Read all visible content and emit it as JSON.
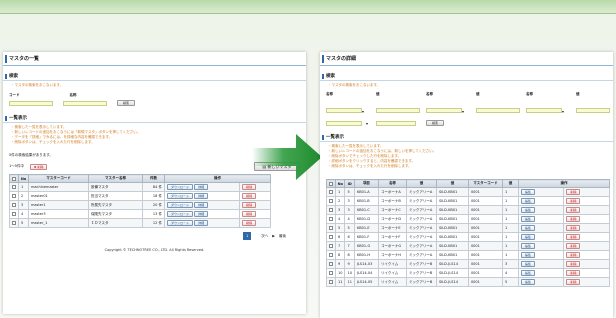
{
  "left": {
    "title": "マスタの一覧",
    "search_section": "検索",
    "search_note": "・マスタの検索をおこないます。",
    "code_label": "コード",
    "name_label": "名称",
    "search_button": "検索",
    "list_section": "一覧表示",
    "list_notes": [
      "・検索した一覧を表示しています。",
      "・新しいレコードの追加をおこなうには「新規マスタ」ボタンを押してください。",
      "・データを「詳細」でみるには、を詳細な内容を確認できます。",
      "・削除ボタンは、チェックを入れた行を削除します。"
    ],
    "result_count": "5件の検索結果があります。",
    "page_info": "1～5件中",
    "delete_button": "削除",
    "new_button": "新しいマスタ",
    "columns": [
      "",
      "No",
      "マスターコード",
      "マスター名称",
      "件数",
      "",
      "操作"
    ],
    "rows": [
      {
        "no": "1",
        "code": "machinemaster",
        "name": "設備マスタ",
        "count": "84 件"
      },
      {
        "no": "2",
        "code": "master01",
        "name": "担当マスタ",
        "count": "18 件"
      },
      {
        "no": "3",
        "code": "master1",
        "name": "所属先マスタ",
        "count": "20 件"
      },
      {
        "no": "4",
        "code": "master3",
        "name": "保険先マスタ",
        "count": "13 件"
      },
      {
        "no": "5",
        "code": "master_1",
        "name": "ＩＤマスタ",
        "count": "12 件"
      }
    ],
    "detail_label": "ダウンロード",
    "edit_label": "詳細",
    "row_delete_label": "削除",
    "pager_current": "1",
    "pager_next": "次へ",
    "pager_last": "最後",
    "copyright": "Copyright © TECHNOTREE CO., LTD. All Rights Reserved."
  },
  "right": {
    "title": "マスタの詳細",
    "search_section": "検索",
    "search_note": "・マスタの検索をおこないます。",
    "field_labels": [
      "名称",
      "値",
      "名称",
      "値",
      "名称",
      "値"
    ],
    "search_button": "検索",
    "list_section": "一覧表示",
    "list_notes": [
      "・検索した一覧を表示しています。",
      "・新しいレコードの追加をおこなうには、新しいを押してください。",
      "・削除ボタンでチェックした行を削除します。",
      "・詳細ボタンをクリックすると、内容を確認できます。",
      "・削除ボタンは、チェックを入れた行を削除します。"
    ],
    "columns": [
      "",
      "No",
      "ID",
      "項目",
      "名称",
      "値",
      "値",
      "マスターコード",
      "値",
      "",
      "操作"
    ],
    "rows": [
      {
        "no": "1",
        "id": "5",
        "c1": "KB01-A",
        "c2": "コーポーナA",
        "c3": "ミックアリーA",
        "c4": "SILD-KB01",
        "c5": "0001",
        "c6": "1"
      },
      {
        "no": "2",
        "id": "3",
        "c1": "KB01-B",
        "c2": "コーポーナB",
        "c3": "ミックアリーA",
        "c4": "SILD-KB01",
        "c5": "0001",
        "c6": "1"
      },
      {
        "no": "3",
        "id": "3",
        "c1": "KB01-C",
        "c2": "コーポーナC",
        "c3": "ミックアリーA",
        "c4": "SILD-KB01",
        "c5": "0001",
        "c6": "1"
      },
      {
        "no": "4",
        "id": "4",
        "c1": "KB01-D",
        "c2": "コーポーナD",
        "c3": "ミックアリーA",
        "c4": "SILD-KB01",
        "c5": "0001",
        "c6": "1"
      },
      {
        "no": "5",
        "id": "5",
        "c1": "KB01-E",
        "c2": "コーポーナE",
        "c3": "ミックアリーA",
        "c4": "SILD-KB01",
        "c5": "0001",
        "c6": "1"
      },
      {
        "no": "6",
        "id": "6",
        "c1": "KB01-F",
        "c2": "コーポーナF",
        "c3": "ミックアリーA",
        "c4": "SILD-KB01",
        "c5": "0001",
        "c6": "1"
      },
      {
        "no": "7",
        "id": "7",
        "c1": "KB01-G",
        "c2": "コーポーナG",
        "c3": "ミックアリーA",
        "c4": "SILD-KB01",
        "c5": "0001",
        "c6": "1"
      },
      {
        "no": "8",
        "id": "8",
        "c1": "KB01-H",
        "c2": "コーポーナH",
        "c3": "ミックアリーA",
        "c4": "SILD-KB01",
        "c5": "0001",
        "c6": "1"
      },
      {
        "no": "9",
        "id": "9",
        "c1": "JLS14-03",
        "c2": "リイクイム",
        "c3": "ミックアリーB",
        "c4": "SILD-JLS14",
        "c5": "0001",
        "c6": "3"
      },
      {
        "no": "10",
        "id": "10",
        "c1": "JLS14-04",
        "c2": "リイクイム",
        "c3": "ミックアリーB",
        "c4": "SILD-JLS14",
        "c5": "0001",
        "c6": "4"
      },
      {
        "no": "11",
        "id": "11",
        "c1": "JLS14-05",
        "c2": "リイクイム",
        "c3": "ミックアリーB",
        "c4": "SILD-JLS14",
        "c5": "0001",
        "c6": "5"
      }
    ],
    "edit_label": "編集",
    "row_delete_label": "削除"
  },
  "colors": {
    "accent_blue": "#2e6aa8",
    "note_orange": "#d07a1b",
    "arrow_green": "#2e9b3e",
    "field_yellow": "#f9fbd0"
  }
}
